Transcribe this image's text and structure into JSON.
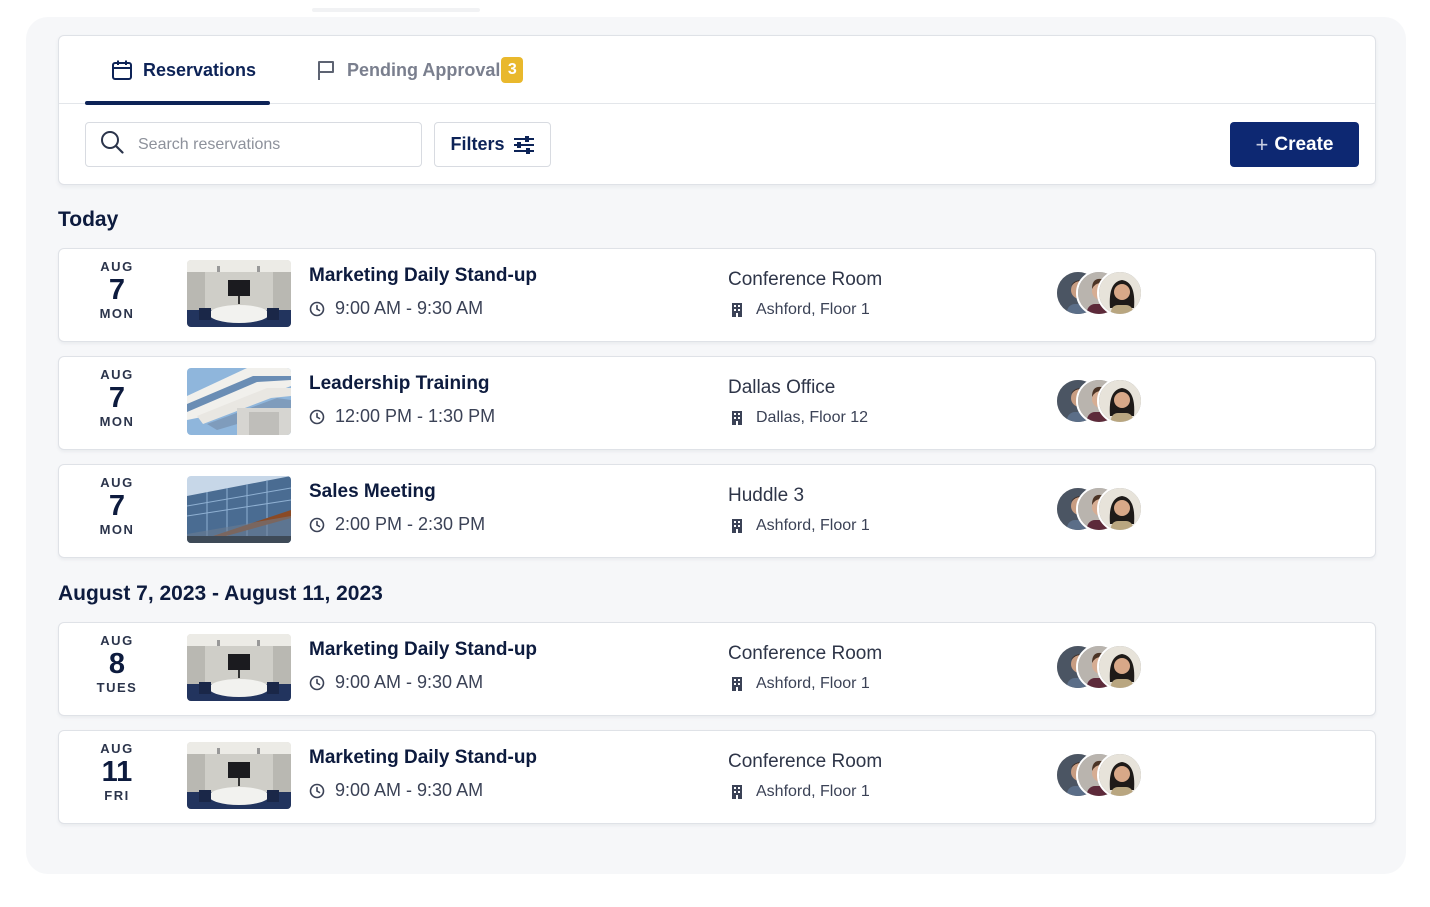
{
  "tabs": {
    "reservations": {
      "label": "Reservations",
      "icon": "calendar-icon"
    },
    "pending": {
      "label": "Pending Approval",
      "icon": "flag-icon",
      "count": "3"
    }
  },
  "toolbar": {
    "search_placeholder": "Search reservations",
    "filters_label": "Filters",
    "create_label": "Create"
  },
  "sections": {
    "today": "Today",
    "range": "August 7, 2023 - August 11, 2023"
  },
  "reservations": [
    {
      "month": "AUG",
      "day": "7",
      "weekday": "MON",
      "title": "Marketing Daily Stand-up",
      "time": "9:00 AM - 9:30 AM",
      "room": "Conference Room",
      "building": "Ashford, Floor 1",
      "image": "conference-room"
    },
    {
      "month": "AUG",
      "day": "7",
      "weekday": "MON",
      "title": "Leadership Training",
      "time": "12:00 PM - 1:30 PM",
      "room": "Dallas Office",
      "building": "Dallas, Floor 12",
      "image": "office-building"
    },
    {
      "month": "AUG",
      "day": "7",
      "weekday": "MON",
      "title": "Sales Meeting",
      "time": "2:00 PM - 2:30 PM",
      "room": "Huddle 3",
      "building": "Ashford, Floor 1",
      "image": "glass-tower"
    },
    {
      "month": "AUG",
      "day": "8",
      "weekday": "TUES",
      "title": "Marketing Daily Stand-up",
      "time": "9:00 AM - 9:30 AM",
      "room": "Conference Room",
      "building": "Ashford, Floor 1",
      "image": "conference-room"
    },
    {
      "month": "AUG",
      "day": "11",
      "weekday": "FRI",
      "title": "Marketing Daily Stand-up",
      "time": "9:00 AM - 9:30 AM",
      "room": "Conference Room",
      "building": "Ashford, Floor 1",
      "image": "conference-room"
    }
  ],
  "colors": {
    "primary": "#0d2872",
    "badge": "#e9b82c",
    "panel": "#f6f7f9"
  }
}
